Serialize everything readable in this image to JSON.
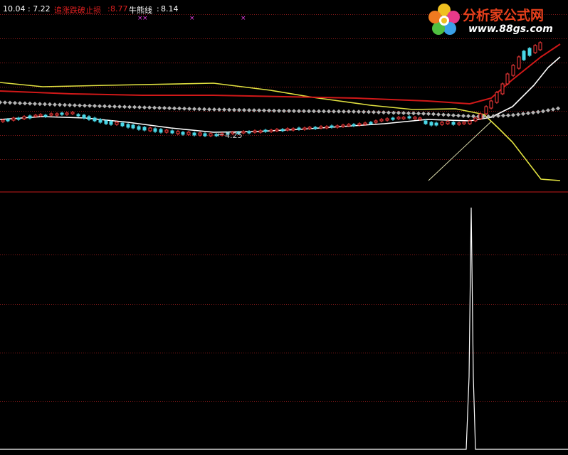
{
  "header": {
    "price_text": "10.04 : 7.22",
    "stop_label": "追涨跌破止损",
    "stop_value": "8.77",
    "bull_label": "牛熊线",
    "bull_value": "8.14"
  },
  "logo": {
    "title": "分析家公式网",
    "url": "www.88gs.com"
  },
  "colors": {
    "background": "#000000",
    "grid": "#8a1a1a",
    "divider": "#c41a1a",
    "yellow": "#e0e040",
    "red": "#d01818",
    "white": "#ffffff",
    "gray": "#b4b4b4",
    "up_candle": "#ff3c3c",
    "down_candle": "#4ad8e8",
    "marker": "#e040e0"
  },
  "chart_data": {
    "type": "line",
    "upper_panel": {
      "annotation_low": "4.25",
      "series": [
        {
          "name": "追涨跌破止损",
          "color": "yellow",
          "points": [
            [
              0,
              116
            ],
            [
              60,
              122
            ],
            [
              150,
              120
            ],
            [
              300,
              117
            ],
            [
              380,
              127
            ],
            [
              440,
              137
            ],
            [
              520,
              148
            ],
            [
              580,
              154
            ],
            [
              640,
              153
            ],
            [
              680,
              161
            ],
            [
              700,
              180
            ],
            [
              720,
              200
            ],
            [
              740,
              226
            ],
            [
              760,
              252
            ],
            [
              787,
              254
            ]
          ]
        },
        {
          "name": "牛熊线",
          "color": "red",
          "points": [
            [
              0,
              128
            ],
            [
              100,
              132
            ],
            [
              200,
              134
            ],
            [
              300,
              134
            ],
            [
              400,
              136
            ],
            [
              500,
              138
            ],
            [
              600,
              142
            ],
            [
              660,
              146
            ],
            [
              690,
              138
            ],
            [
              720,
              112
            ],
            [
              760,
              80
            ],
            [
              787,
              62
            ]
          ]
        },
        {
          "name": "",
          "color": "white",
          "points": [
            [
              0,
              168
            ],
            [
              60,
              164
            ],
            [
              120,
              166
            ],
            [
              180,
              172
            ],
            [
              240,
              180
            ],
            [
              300,
              186
            ],
            [
              360,
              185
            ],
            [
              420,
              182
            ],
            [
              480,
              178
            ],
            [
              540,
              174
            ],
            [
              600,
              168
            ],
            [
              660,
              170
            ],
            [
              690,
              165
            ],
            [
              720,
              150
            ],
            [
              750,
              120
            ],
            [
              770,
              95
            ],
            [
              787,
              80
            ]
          ]
        },
        {
          "name": "",
          "color": "gray",
          "style": "diamond",
          "points": [
            [
              0,
              144
            ],
            [
              100,
              148
            ],
            [
              200,
              151
            ],
            [
              300,
              154
            ],
            [
              400,
              156
            ],
            [
              500,
              157
            ],
            [
              600,
              160
            ],
            [
              650,
              163
            ],
            [
              680,
              164
            ],
            [
              720,
              162
            ],
            [
              760,
              157
            ],
            [
              787,
              152
            ]
          ]
        }
      ],
      "candles": [
        [
          2,
          170,
          169,
          1
        ],
        [
          9,
          170,
          168,
          -1
        ],
        [
          17,
          169,
          166,
          1
        ],
        [
          24,
          168,
          166,
          -1
        ],
        [
          32,
          167,
          164,
          1
        ],
        [
          40,
          166,
          163,
          -1
        ],
        [
          48,
          164,
          162,
          1
        ],
        [
          55,
          163,
          161,
          1
        ],
        [
          62,
          163,
          162,
          -1
        ],
        [
          70,
          162,
          160,
          1
        ],
        [
          78,
          162,
          160,
          1
        ],
        [
          85,
          161,
          159,
          -1
        ],
        [
          92,
          161,
          159,
          1
        ],
        [
          100,
          160,
          158,
          1
        ],
        [
          108,
          161,
          163,
          -1
        ],
        [
          116,
          162,
          166,
          -1
        ],
        [
          123,
          164,
          168,
          -1
        ],
        [
          131,
          166,
          170,
          -1
        ],
        [
          139,
          168,
          172,
          -1
        ],
        [
          147,
          170,
          174,
          -1
        ],
        [
          154,
          171,
          175,
          -1
        ],
        [
          162,
          172,
          175,
          1
        ],
        [
          170,
          173,
          177,
          -1
        ],
        [
          178,
          175,
          179,
          -1
        ],
        [
          185,
          176,
          180,
          -1
        ],
        [
          193,
          178,
          182,
          -1
        ],
        [
          201,
          179,
          183,
          -1
        ],
        [
          209,
          180,
          184,
          1
        ],
        [
          216,
          181,
          185,
          -1
        ],
        [
          224,
          182,
          186,
          -1
        ],
        [
          232,
          183,
          186,
          1
        ],
        [
          240,
          184,
          187,
          -1
        ],
        [
          248,
          185,
          188,
          1
        ],
        [
          255,
          186,
          189,
          -1
        ],
        [
          263,
          186,
          189,
          1
        ],
        [
          271,
          187,
          190,
          -1
        ],
        [
          279,
          187,
          190,
          1
        ],
        [
          286,
          188,
          191,
          -1
        ],
        [
          294,
          188,
          191,
          1
        ],
        [
          302,
          189,
          191,
          -1
        ],
        [
          310,
          188,
          190,
          1
        ],
        [
          318,
          187,
          189,
          -1
        ],
        [
          325,
          186,
          188,
          1
        ],
        [
          333,
          186,
          188,
          -1
        ],
        [
          340,
          185,
          187,
          1
        ],
        [
          348,
          185,
          187,
          -1
        ],
        [
          356,
          184,
          186,
          1
        ],
        [
          364,
          184,
          186,
          1
        ],
        [
          371,
          183,
          185,
          -1
        ],
        [
          379,
          183,
          185,
          1
        ],
        [
          387,
          182,
          184,
          1
        ],
        [
          395,
          182,
          184,
          -1
        ],
        [
          402,
          181,
          183,
          1
        ],
        [
          410,
          181,
          183,
          1
        ],
        [
          418,
          180,
          182,
          -1
        ],
        [
          426,
          180,
          182,
          1
        ],
        [
          433,
          179,
          181,
          1
        ],
        [
          441,
          179,
          181,
          -1
        ],
        [
          449,
          178,
          180,
          1
        ],
        [
          457,
          178,
          180,
          1
        ],
        [
          464,
          177,
          179,
          -1
        ],
        [
          472,
          177,
          179,
          1
        ],
        [
          480,
          176,
          178,
          1
        ],
        [
          488,
          175,
          177,
          1
        ],
        [
          495,
          175,
          177,
          -1
        ],
        [
          503,
          174,
          176,
          1
        ],
        [
          511,
          173,
          175,
          1
        ],
        [
          519,
          172,
          174,
          -1
        ],
        [
          526,
          170,
          172,
          1
        ],
        [
          534,
          168,
          170,
          1
        ],
        [
          542,
          167,
          169,
          1
        ],
        [
          550,
          166,
          168,
          -1
        ],
        [
          558,
          165,
          167,
          1
        ],
        [
          565,
          165,
          167,
          1
        ],
        [
          573,
          164,
          166,
          -1
        ],
        [
          581,
          165,
          167,
          1
        ],
        [
          588,
          166,
          168,
          1
        ],
        [
          596,
          170,
          174,
          -1
        ],
        [
          604,
          172,
          176,
          -1
        ],
        [
          611,
          173,
          176,
          -1
        ],
        [
          619,
          172,
          175,
          1
        ],
        [
          627,
          171,
          174,
          1
        ],
        [
          635,
          172,
          175,
          -1
        ],
        [
          643,
          173,
          175,
          1
        ],
        [
          650,
          172,
          174,
          1
        ],
        [
          658,
          170,
          174,
          1
        ],
        [
          666,
          166,
          170,
          1
        ],
        [
          673,
          160,
          167,
          1
        ],
        [
          681,
          150,
          160,
          1
        ],
        [
          688,
          142,
          152,
          1
        ],
        [
          696,
          130,
          144,
          1
        ],
        [
          704,
          118,
          132,
          1
        ],
        [
          711,
          104,
          118,
          1
        ],
        [
          719,
          92,
          106,
          1
        ],
        [
          727,
          80,
          96,
          1
        ],
        [
          734,
          72,
          84,
          -1
        ],
        [
          742,
          68,
          78,
          -1
        ],
        [
          750,
          64,
          74,
          1
        ],
        [
          757,
          60,
          70,
          1
        ]
      ],
      "markers_x": [
        193,
        200,
        266,
        338
      ]
    },
    "lower_panel": {
      "series": [
        {
          "name": "",
          "color": "white",
          "points": [
            [
              0,
              632
            ],
            [
              655,
              632
            ],
            [
              659,
              530
            ],
            [
              662,
              292
            ],
            [
              665,
              530
            ],
            [
              668,
              632
            ],
            [
              798,
              632
            ]
          ]
        }
      ]
    }
  }
}
